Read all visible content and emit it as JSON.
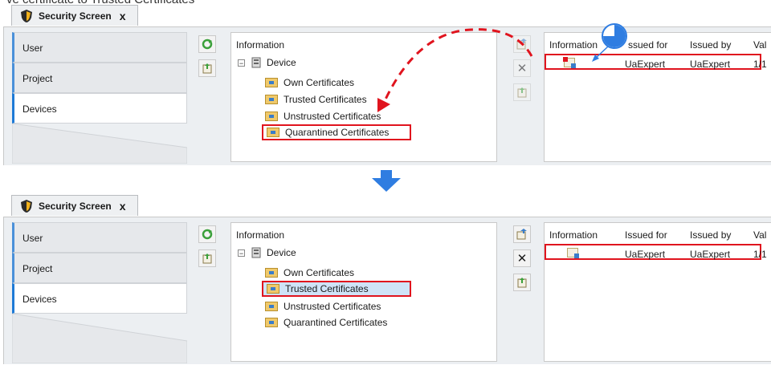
{
  "caption": "ve certificate to Trusted Certificates",
  "tab": {
    "title": "Security Screen",
    "close_label": "x",
    "icon": "shield-icon"
  },
  "sidebar": {
    "items": [
      {
        "label": "User"
      },
      {
        "label": "Project"
      },
      {
        "label": "Devices"
      }
    ]
  },
  "tree": {
    "header": "Information",
    "device": {
      "label": "Device",
      "expander": "−"
    },
    "folders": [
      {
        "label": "Own Certificates"
      },
      {
        "label": "Trusted Certificates"
      },
      {
        "label": "Unstrusted Certificates"
      },
      {
        "label": "Quarantined Certificates"
      }
    ]
  },
  "table": {
    "columns": [
      "Information",
      "Issued for",
      "Issued by",
      "Val"
    ],
    "before_columns": [
      "Information",
      "ssued for",
      "Issued by",
      "Val"
    ],
    "row": {
      "issued_for": "UaExpert",
      "issued_by": "UaExpert",
      "valid": "1/1"
    }
  },
  "toolbar": {
    "left": [
      "refresh-icon",
      "import-icon"
    ],
    "right_before": [
      "trust-icon",
      "delete-icon",
      "export-icon"
    ],
    "right_after": [
      "trust-icon",
      "delete-icon",
      "export-icon"
    ],
    "delete_glyph": "✕"
  },
  "colors": {
    "highlight": "#e0141e",
    "selection": "#cfe3f7",
    "accent": "#1e7ad6",
    "arrow": "#2f7de1"
  }
}
